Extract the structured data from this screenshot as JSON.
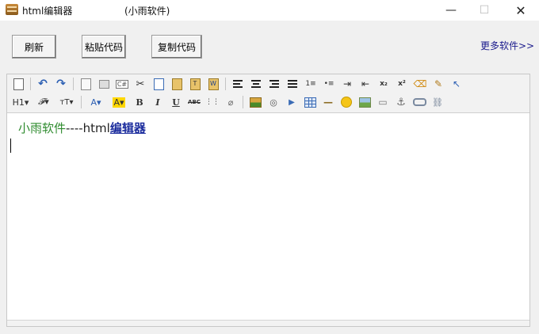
{
  "window": {
    "title": "html编辑器",
    "subtitle": "(小雨软件)",
    "minimize_glyph": "—",
    "maximize_glyph": "☐",
    "close_glyph": "✕"
  },
  "actions": {
    "refresh": "刷新",
    "paste_code": "粘贴代码",
    "copy_code": "复制代码",
    "more_software": "更多软件>>"
  },
  "toolbar": {
    "row1": [
      {
        "name": "source-icon"
      },
      {
        "name": "undo-icon",
        "glyph": "↶"
      },
      {
        "name": "redo-icon",
        "glyph": "↷"
      },
      {
        "name": "preview-icon"
      },
      {
        "name": "print-icon"
      },
      {
        "name": "code-icon",
        "glyph": "C#"
      },
      {
        "name": "cut-icon",
        "glyph": "✂"
      },
      {
        "name": "copy-icon"
      },
      {
        "name": "paste-icon"
      },
      {
        "name": "paste-text-icon",
        "glyph": "T"
      },
      {
        "name": "paste-word-icon",
        "glyph": "W"
      },
      {
        "name": "align-left-icon"
      },
      {
        "name": "align-center-icon"
      },
      {
        "name": "align-right-icon"
      },
      {
        "name": "justify-icon"
      },
      {
        "name": "ordered-list-icon",
        "glyph": "1≡"
      },
      {
        "name": "unordered-list-icon",
        "glyph": "•≡"
      },
      {
        "name": "indent-icon",
        "glyph": "⇥"
      },
      {
        "name": "outdent-icon",
        "glyph": "⇤"
      },
      {
        "name": "subscript-icon",
        "glyph": "x₂"
      },
      {
        "name": "superscript-icon",
        "glyph": "x²"
      },
      {
        "name": "clear-format-icon",
        "glyph": "⌫"
      },
      {
        "name": "quick-format-icon",
        "glyph": "✎"
      },
      {
        "name": "select-all-icon",
        "glyph": "↖"
      }
    ],
    "row2": [
      {
        "name": "heading-icon",
        "glyph": "H1▾"
      },
      {
        "name": "font-family-icon",
        "glyph": "𝓕▾"
      },
      {
        "name": "font-size-icon",
        "glyph": "тT▾"
      },
      {
        "name": "font-color-icon",
        "glyph": "A▾"
      },
      {
        "name": "highlight-color-icon",
        "glyph": "A▾"
      },
      {
        "name": "bold-icon",
        "glyph": "B"
      },
      {
        "name": "italic-icon",
        "glyph": "I"
      },
      {
        "name": "underline-icon",
        "glyph": "U"
      },
      {
        "name": "strikethrough-icon",
        "glyph": "ABC"
      },
      {
        "name": "line-height-icon",
        "glyph": "⋮⋮"
      },
      {
        "name": "eraser-icon",
        "glyph": "⌀"
      },
      {
        "name": "insert-image-icon"
      },
      {
        "name": "insert-flash-icon",
        "glyph": "◎"
      },
      {
        "name": "insert-media-icon",
        "glyph": "▶"
      },
      {
        "name": "insert-table-icon"
      },
      {
        "name": "horizontal-rule-icon",
        "glyph": "—"
      },
      {
        "name": "emoticon-icon"
      },
      {
        "name": "image-manager-icon"
      },
      {
        "name": "page-break-icon",
        "glyph": "▭"
      },
      {
        "name": "anchor-icon",
        "glyph": "⚓"
      },
      {
        "name": "link-icon"
      },
      {
        "name": "unlink-icon",
        "glyph": "⛓"
      }
    ]
  },
  "content": {
    "part1": "小雨软件",
    "part2": "----html",
    "part3": "编辑器"
  },
  "colors": {
    "accent_link": "#1d2e9e",
    "content_green": "#2e8b2e",
    "highlight": "#ffd700"
  }
}
